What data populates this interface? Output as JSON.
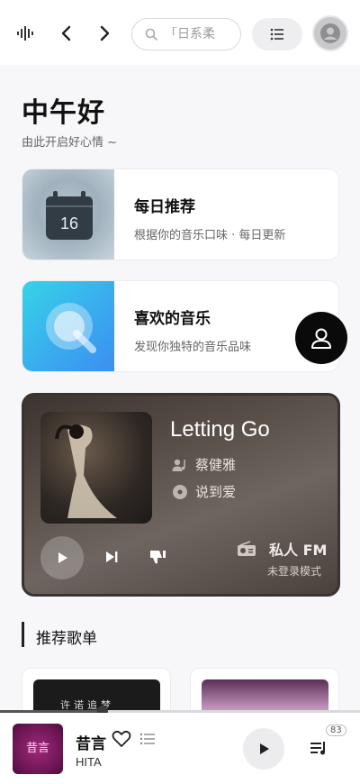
{
  "search": {
    "placeholder": "「日系柔"
  },
  "greeting": {
    "title": "中午好",
    "subtitle": "由此开启好心情 ~"
  },
  "cards": {
    "daily": {
      "title": "每日推荐",
      "desc": "根据你的音乐口味 · 每日更新",
      "day": "16"
    },
    "liked": {
      "title": "喜欢的音乐",
      "desc": "发现你独特的音乐品味"
    }
  },
  "fm": {
    "song": "Letting Go",
    "artist": "蔡健雅",
    "album": "说到爱",
    "label": "私人 FM",
    "mode": "未登录模式"
  },
  "section": {
    "title": "推荐歌单"
  },
  "playlists": [
    {
      "text": "许诺追梦"
    },
    {
      "text": ""
    }
  ],
  "player": {
    "title": "昔言",
    "artist": "HITA",
    "cover_text": "昔言",
    "queue_count": "83",
    "progress": 0.285
  },
  "colors": {
    "accent": "#111111",
    "fm_bg": "#5a504a",
    "liked_gradient_start": "#36d3e8"
  }
}
